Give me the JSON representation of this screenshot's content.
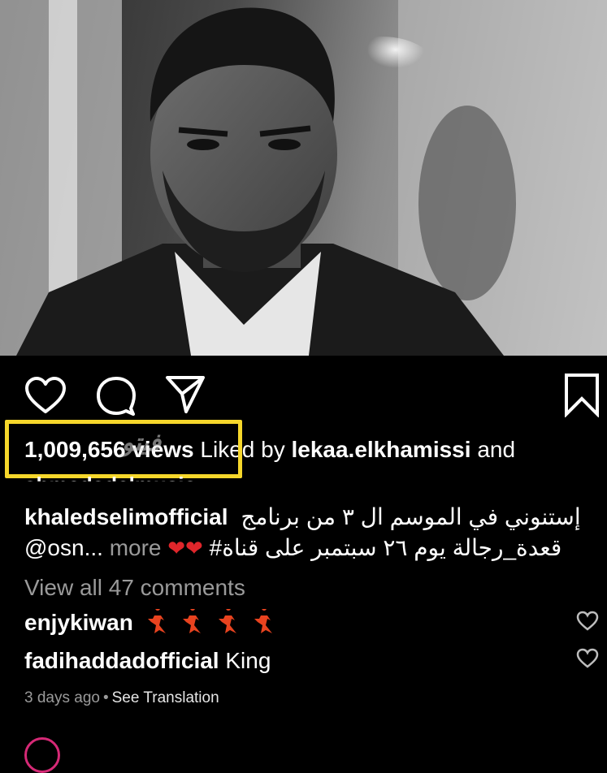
{
  "post": {
    "views_count": "1,009,656 views",
    "liked_by_prefix": "Liked by",
    "liked_by_user": "lekaa.elkhamissi",
    "liked_by_suffix": "and",
    "liked_by_second_user": "ahmedadelmusic",
    "watermark": "فيتو",
    "caption_user": "khaledselimofficial",
    "caption_line1_ar": "إستنوني في الموسم ال ٣ من برنامج",
    "caption_line2_ar": "قعدة_رجالة يوم ٢٦ سبتمبر على قناة#",
    "caption_mention": "@osn...",
    "more_label": "more",
    "view_all_comments": "View all 47 comments",
    "timestamp": "3 days ago",
    "see_translation": "See Translation"
  },
  "comments": [
    {
      "user": "enjykiwan",
      "text": "💃💃💃💃"
    },
    {
      "user": "fadihaddadofficial",
      "text": "King"
    }
  ],
  "icons": {
    "like": "heart-outline-icon",
    "comment": "comment-bubble-icon",
    "share": "paper-plane-icon",
    "save": "bookmark-icon",
    "comment_like": "small-heart-icon"
  },
  "colors": {
    "highlight": "#f6d72b",
    "secondary_text": "#9a9a9a",
    "heart_emoji": "#e0262b",
    "dancer_emoji": "#e8431f"
  }
}
